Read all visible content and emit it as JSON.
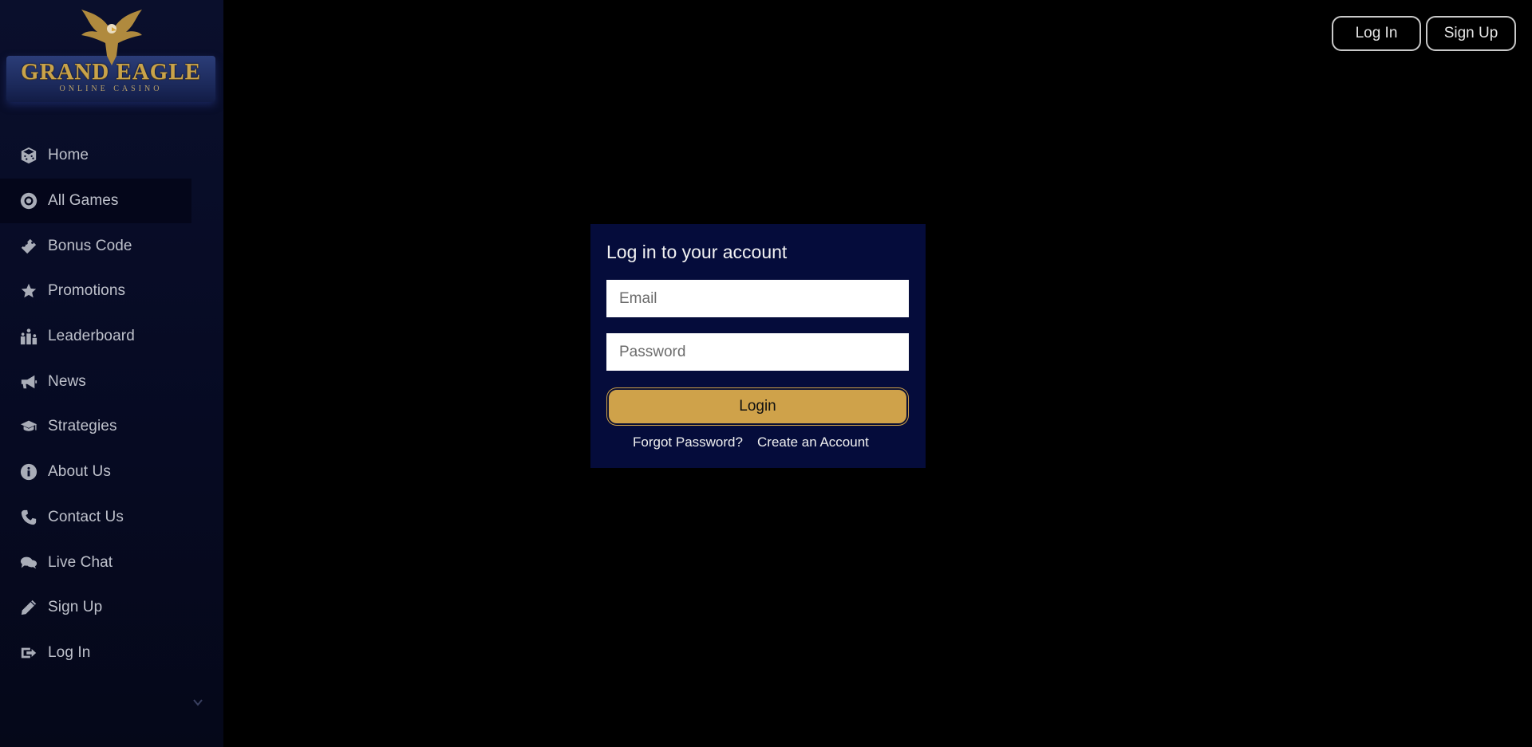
{
  "brand": {
    "name": "GRAND EAGLE",
    "tagline": "ONLINE CASINO",
    "gold": "#c9a34a",
    "navy": "#050c3b"
  },
  "sidebar": {
    "items": [
      {
        "label": "Home",
        "icon": "dice-icon"
      },
      {
        "label": "All Games",
        "icon": "poker-chip-icon"
      },
      {
        "label": "Bonus Code",
        "icon": "ticket-icon"
      },
      {
        "label": "Promotions",
        "icon": "star-icon"
      },
      {
        "label": "Leaderboard",
        "icon": "podium-icon"
      },
      {
        "label": "News",
        "icon": "megaphone-icon"
      },
      {
        "label": "Strategies",
        "icon": "graduation-cap-icon"
      },
      {
        "label": "About Us",
        "icon": "info-icon"
      },
      {
        "label": "Contact Us",
        "icon": "phone-icon"
      },
      {
        "label": "Live Chat",
        "icon": "chat-icon"
      },
      {
        "label": "Sign Up",
        "icon": "pencil-icon"
      },
      {
        "label": "Log In",
        "icon": "sign-in-icon"
      }
    ],
    "active_index": 1
  },
  "header": {
    "login_label": "Log In",
    "signup_label": "Sign Up"
  },
  "login_modal": {
    "title": "Log in to your account",
    "email_placeholder": "Email",
    "password_placeholder": "Password",
    "submit_label": "Login",
    "forgot_label": "Forgot Password?",
    "create_label": "Create an Account"
  }
}
